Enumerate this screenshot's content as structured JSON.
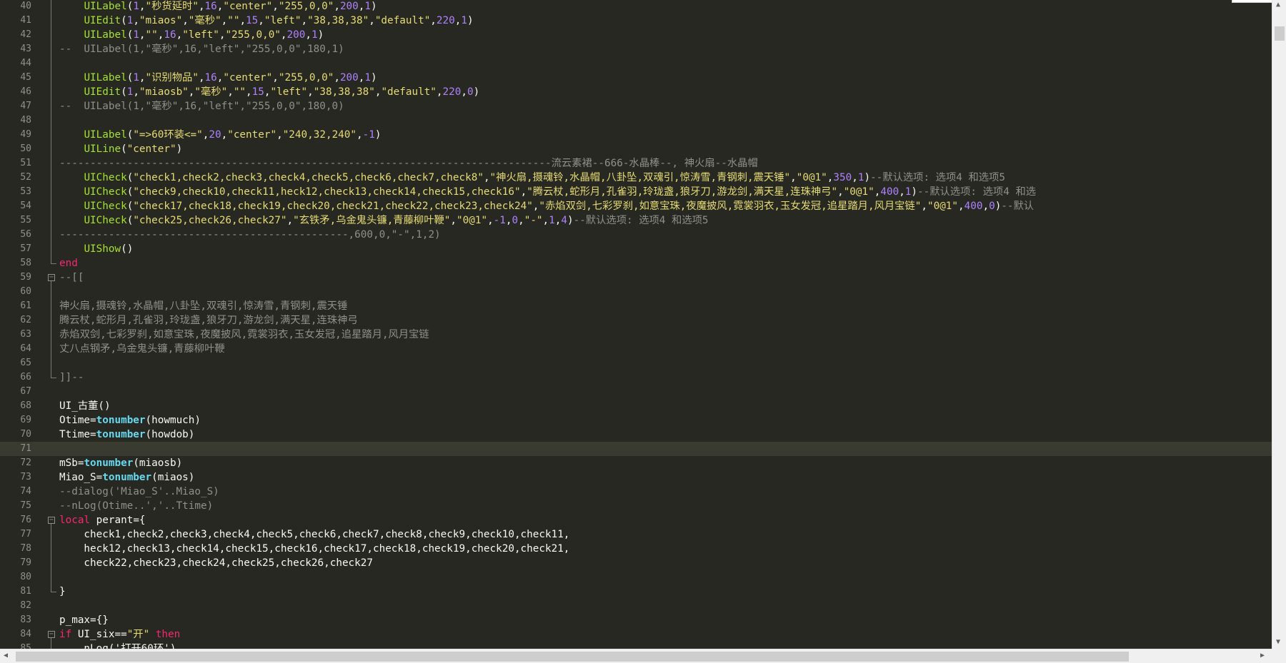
{
  "editor": {
    "current_line": 71,
    "lines": [
      {
        "n": "40",
        "fold": "line",
        "tokens": [
          [
            "tx",
            "    "
          ],
          [
            "fn",
            "UILabel"
          ],
          [
            "op",
            "("
          ],
          [
            "num",
            "1"
          ],
          [
            "op",
            ","
          ],
          [
            "str",
            "\"秒货延时\""
          ],
          [
            "op",
            ","
          ],
          [
            "num",
            "16"
          ],
          [
            "op",
            ","
          ],
          [
            "str",
            "\"center\""
          ],
          [
            "op",
            ","
          ],
          [
            "str",
            "\"255,0,0\""
          ],
          [
            "op",
            ","
          ],
          [
            "num",
            "200"
          ],
          [
            "op",
            ","
          ],
          [
            "num",
            "1"
          ],
          [
            "op",
            ")"
          ]
        ]
      },
      {
        "n": "41",
        "fold": "line",
        "tokens": [
          [
            "tx",
            "    "
          ],
          [
            "fn",
            "UIEdit"
          ],
          [
            "op",
            "("
          ],
          [
            "num",
            "1"
          ],
          [
            "op",
            ","
          ],
          [
            "str",
            "\"miaos\""
          ],
          [
            "op",
            ","
          ],
          [
            "str",
            "\"毫秒\""
          ],
          [
            "op",
            ","
          ],
          [
            "str",
            "\"\""
          ],
          [
            "op",
            ","
          ],
          [
            "num",
            "15"
          ],
          [
            "op",
            ","
          ],
          [
            "str",
            "\"left\""
          ],
          [
            "op",
            ","
          ],
          [
            "str",
            "\"38,38,38\""
          ],
          [
            "op",
            ","
          ],
          [
            "str",
            "\"default\""
          ],
          [
            "op",
            ","
          ],
          [
            "num",
            "220"
          ],
          [
            "op",
            ","
          ],
          [
            "num",
            "1"
          ],
          [
            "op",
            ")"
          ]
        ]
      },
      {
        "n": "42",
        "fold": "line",
        "tokens": [
          [
            "tx",
            "    "
          ],
          [
            "fn",
            "UILabel"
          ],
          [
            "op",
            "("
          ],
          [
            "num",
            "1"
          ],
          [
            "op",
            ","
          ],
          [
            "str",
            "\"\""
          ],
          [
            "op",
            ","
          ],
          [
            "num",
            "16"
          ],
          [
            "op",
            ","
          ],
          [
            "str",
            "\"left\""
          ],
          [
            "op",
            ","
          ],
          [
            "str",
            "\"255,0,0\""
          ],
          [
            "op",
            ","
          ],
          [
            "num",
            "200"
          ],
          [
            "op",
            ","
          ],
          [
            "num",
            "1"
          ],
          [
            "op",
            ")"
          ]
        ]
      },
      {
        "n": "43",
        "fold": "line",
        "tokens": [
          [
            "cm",
            "--  UILabel(1,\"毫秒\",16,\"left\",\"255,0,0\",180,1)"
          ]
        ]
      },
      {
        "n": "44",
        "fold": "line",
        "tokens": []
      },
      {
        "n": "45",
        "fold": "line",
        "tokens": [
          [
            "tx",
            "    "
          ],
          [
            "fn",
            "UILabel"
          ],
          [
            "op",
            "("
          ],
          [
            "num",
            "1"
          ],
          [
            "op",
            ","
          ],
          [
            "str",
            "\"识别物品\""
          ],
          [
            "op",
            ","
          ],
          [
            "num",
            "16"
          ],
          [
            "op",
            ","
          ],
          [
            "str",
            "\"center\""
          ],
          [
            "op",
            ","
          ],
          [
            "str",
            "\"255,0,0\""
          ],
          [
            "op",
            ","
          ],
          [
            "num",
            "200"
          ],
          [
            "op",
            ","
          ],
          [
            "num",
            "1"
          ],
          [
            "op",
            ")"
          ]
        ]
      },
      {
        "n": "46",
        "fold": "line",
        "tokens": [
          [
            "tx",
            "    "
          ],
          [
            "fn",
            "UIEdit"
          ],
          [
            "op",
            "("
          ],
          [
            "num",
            "1"
          ],
          [
            "op",
            ","
          ],
          [
            "str",
            "\"miaosb\""
          ],
          [
            "op",
            ","
          ],
          [
            "str",
            "\"毫秒\""
          ],
          [
            "op",
            ","
          ],
          [
            "str",
            "\"\""
          ],
          [
            "op",
            ","
          ],
          [
            "num",
            "15"
          ],
          [
            "op",
            ","
          ],
          [
            "str",
            "\"left\""
          ],
          [
            "op",
            ","
          ],
          [
            "str",
            "\"38,38,38\""
          ],
          [
            "op",
            ","
          ],
          [
            "str",
            "\"default\""
          ],
          [
            "op",
            ","
          ],
          [
            "num",
            "220"
          ],
          [
            "op",
            ","
          ],
          [
            "num",
            "0"
          ],
          [
            "op",
            ")"
          ]
        ]
      },
      {
        "n": "47",
        "fold": "line",
        "tokens": [
          [
            "cm",
            "--  UILabel(1,\"毫秒\",16,\"left\",\"255,0,0\",180,0)"
          ]
        ]
      },
      {
        "n": "48",
        "fold": "line",
        "tokens": []
      },
      {
        "n": "49",
        "fold": "line",
        "tokens": [
          [
            "tx",
            "    "
          ],
          [
            "fn",
            "UILabel"
          ],
          [
            "op",
            "("
          ],
          [
            "str",
            "\"=>60环装<=\""
          ],
          [
            "op",
            ","
          ],
          [
            "num",
            "20"
          ],
          [
            "op",
            ","
          ],
          [
            "str",
            "\"center\""
          ],
          [
            "op",
            ","
          ],
          [
            "str",
            "\"240,32,240\""
          ],
          [
            "op",
            ","
          ],
          [
            "num",
            "-1"
          ],
          [
            "op",
            ")"
          ]
        ]
      },
      {
        "n": "50",
        "fold": "line",
        "tokens": [
          [
            "tx",
            "    "
          ],
          [
            "fn",
            "UILine"
          ],
          [
            "op",
            "("
          ],
          [
            "str",
            "\"center\""
          ],
          [
            "op",
            ")"
          ]
        ]
      },
      {
        "n": "51",
        "fold": "line",
        "tokens": [
          [
            "cm",
            "--------------------------------------------------------------------------------流云素裙--666-水晶棒--, 神火扇--水晶帽"
          ]
        ]
      },
      {
        "n": "52",
        "fold": "line",
        "tokens": [
          [
            "tx",
            "    "
          ],
          [
            "fn",
            "UICheck"
          ],
          [
            "op",
            "("
          ],
          [
            "str",
            "\"check1,check2,check3,check4,check5,check6,check7,check8\""
          ],
          [
            "op",
            ","
          ],
          [
            "str",
            "\"神火扇,摄魂铃,水晶帽,八卦坠,双魂引,惊涛雪,青钢刺,震天锤\""
          ],
          [
            "op",
            ","
          ],
          [
            "str",
            "\"0@1\""
          ],
          [
            "op",
            ","
          ],
          [
            "num",
            "350"
          ],
          [
            "op",
            ","
          ],
          [
            "num",
            "1"
          ],
          [
            "op",
            ")"
          ],
          [
            "cm",
            "--默认选项: 选项4 和选项5"
          ]
        ]
      },
      {
        "n": "53",
        "fold": "line",
        "tokens": [
          [
            "tx",
            "    "
          ],
          [
            "fn",
            "UICheck"
          ],
          [
            "op",
            "("
          ],
          [
            "str",
            "\"check9,check10,check11,heck12,check13,check14,check15,check16\""
          ],
          [
            "op",
            ","
          ],
          [
            "str",
            "\"腾云杖,蛇形月,孔雀羽,玲珑盏,狼牙刀,游龙剑,满天星,连珠神弓\""
          ],
          [
            "op",
            ","
          ],
          [
            "str",
            "\"0@1\""
          ],
          [
            "op",
            ","
          ],
          [
            "num",
            "400"
          ],
          [
            "op",
            ","
          ],
          [
            "num",
            "1"
          ],
          [
            "op",
            ")"
          ],
          [
            "cm",
            "--默认选项: 选项4 和选"
          ]
        ]
      },
      {
        "n": "54",
        "fold": "line",
        "tokens": [
          [
            "tx",
            "    "
          ],
          [
            "fn",
            "UICheck"
          ],
          [
            "op",
            "("
          ],
          [
            "str",
            "\"check17,check18,check19,check20,check21,check22,check23,check24\""
          ],
          [
            "op",
            ","
          ],
          [
            "str",
            "\"赤焰双剑,七彩罗刹,如意宝珠,夜魔披风,霓裳羽衣,玉女发冠,追星踏月,风月宝链\""
          ],
          [
            "op",
            ","
          ],
          [
            "str",
            "\"0@1\""
          ],
          [
            "op",
            ","
          ],
          [
            "num",
            "400"
          ],
          [
            "op",
            ","
          ],
          [
            "num",
            "0"
          ],
          [
            "op",
            ")"
          ],
          [
            "cm",
            "--默认"
          ]
        ]
      },
      {
        "n": "55",
        "fold": "line",
        "tokens": [
          [
            "tx",
            "    "
          ],
          [
            "fn",
            "UICheck"
          ],
          [
            "op",
            "("
          ],
          [
            "str",
            "\"check25,check26,check27\""
          ],
          [
            "op",
            ","
          ],
          [
            "str",
            "\"玄铁矛,乌金鬼头镰,青藤柳叶鞭\""
          ],
          [
            "op",
            ","
          ],
          [
            "str",
            "\"0@1\""
          ],
          [
            "op",
            ","
          ],
          [
            "num",
            "-1"
          ],
          [
            "op",
            ","
          ],
          [
            "num",
            "0"
          ],
          [
            "op",
            ","
          ],
          [
            "str",
            "\"-\""
          ],
          [
            "op",
            ","
          ],
          [
            "num",
            "1"
          ],
          [
            "op",
            ","
          ],
          [
            "num",
            "4"
          ],
          [
            "op",
            ")"
          ],
          [
            "cm",
            "--默认选项: 选项4 和选项5"
          ]
        ]
      },
      {
        "n": "56",
        "fold": "line",
        "tokens": [
          [
            "cm",
            "-----------------------------------------------,600,0,\"-\",1,2)"
          ]
        ]
      },
      {
        "n": "57",
        "fold": "line",
        "tokens": [
          [
            "tx",
            "    "
          ],
          [
            "fn",
            "UIShow"
          ],
          [
            "op",
            "()"
          ]
        ]
      },
      {
        "n": "58",
        "fold": "end",
        "tokens": [
          [
            "kw",
            "end"
          ]
        ]
      },
      {
        "n": "59",
        "fold": "box",
        "tokens": [
          [
            "cm",
            "--[["
          ]
        ]
      },
      {
        "n": "60",
        "fold": "line",
        "tokens": []
      },
      {
        "n": "61",
        "fold": "line",
        "tokens": [
          [
            "cm",
            "神火扇,摄魂铃,水晶帽,八卦坠,双魂引,惊涛雪,青钢刺,震天锤"
          ]
        ]
      },
      {
        "n": "62",
        "fold": "line",
        "tokens": [
          [
            "cm",
            "腾云杖,蛇形月,孔雀羽,玲珑盏,狼牙刀,游龙剑,满天星,连珠神弓"
          ]
        ]
      },
      {
        "n": "63",
        "fold": "line",
        "tokens": [
          [
            "cm",
            "赤焰双剑,七彩罗刹,如意宝珠,夜魔披风,霓裳羽衣,玉女发冠,追星踏月,风月宝链"
          ]
        ]
      },
      {
        "n": "64",
        "fold": "line",
        "tokens": [
          [
            "cm",
            "丈八点钢矛,乌金鬼头镰,青藤柳叶鞭"
          ]
        ]
      },
      {
        "n": "65",
        "fold": "line",
        "tokens": []
      },
      {
        "n": "66",
        "fold": "end",
        "tokens": [
          [
            "cm",
            "]]--"
          ]
        ]
      },
      {
        "n": "67",
        "fold": "",
        "tokens": []
      },
      {
        "n": "68",
        "fold": "",
        "tokens": [
          [
            "tx",
            "UI_古董"
          ],
          [
            "op",
            "()"
          ]
        ]
      },
      {
        "n": "69",
        "fold": "",
        "tokens": [
          [
            "tx",
            "Otime"
          ],
          [
            "op",
            "="
          ],
          [
            "bi",
            "tonumber"
          ],
          [
            "op",
            "("
          ],
          [
            "tx",
            "howmuch"
          ],
          [
            "op",
            ")"
          ]
        ]
      },
      {
        "n": "70",
        "fold": "",
        "tokens": [
          [
            "tx",
            "Ttime"
          ],
          [
            "op",
            "="
          ],
          [
            "bi",
            "tonumber"
          ],
          [
            "op",
            "("
          ],
          [
            "tx",
            "howdob"
          ],
          [
            "op",
            ")"
          ]
        ]
      },
      {
        "n": "71",
        "fold": "",
        "tokens": []
      },
      {
        "n": "72",
        "fold": "",
        "tokens": [
          [
            "tx",
            "mSb"
          ],
          [
            "op",
            "="
          ],
          [
            "bi",
            "tonumber"
          ],
          [
            "op",
            "("
          ],
          [
            "tx",
            "miaosb"
          ],
          [
            "op",
            ")"
          ]
        ]
      },
      {
        "n": "73",
        "fold": "",
        "tokens": [
          [
            "tx",
            "Miao_S"
          ],
          [
            "op",
            "="
          ],
          [
            "bi",
            "tonumber"
          ],
          [
            "op",
            "("
          ],
          [
            "tx",
            "miaos"
          ],
          [
            "op",
            ")"
          ]
        ]
      },
      {
        "n": "74",
        "fold": "",
        "tokens": [
          [
            "cm",
            "--dialog('Miao_S'..Miao_S)"
          ]
        ]
      },
      {
        "n": "75",
        "fold": "",
        "tokens": [
          [
            "cm",
            "--nLog(Otime..','..Ttime)"
          ]
        ]
      },
      {
        "n": "76",
        "fold": "box",
        "tokens": [
          [
            "kw",
            "local"
          ],
          [
            "tx",
            " perant"
          ],
          [
            "op",
            "={"
          ]
        ]
      },
      {
        "n": "77",
        "fold": "line",
        "tokens": [
          [
            "tx",
            "    check1,check2,check3,check4,check5,check6,check7,check8,check9,check10,check11,"
          ]
        ]
      },
      {
        "n": "78",
        "fold": "line",
        "tokens": [
          [
            "tx",
            "    heck12,check13,check14,check15,check16,check17,check18,check19,check20,check21,"
          ]
        ]
      },
      {
        "n": "79",
        "fold": "line",
        "tokens": [
          [
            "tx",
            "    check22,check23,check24,check25,check26,check27"
          ]
        ]
      },
      {
        "n": "80",
        "fold": "line",
        "tokens": []
      },
      {
        "n": "81",
        "fold": "end",
        "tokens": [
          [
            "op",
            "}"
          ]
        ]
      },
      {
        "n": "82",
        "fold": "",
        "tokens": []
      },
      {
        "n": "83",
        "fold": "",
        "tokens": [
          [
            "tx",
            "p_max"
          ],
          [
            "op",
            "={}"
          ]
        ]
      },
      {
        "n": "84",
        "fold": "box",
        "tokens": [
          [
            "kw",
            "if"
          ],
          [
            "tx",
            " UI_six"
          ],
          [
            "op",
            "=="
          ],
          [
            "str",
            "\"开\""
          ],
          [
            "tx",
            " "
          ],
          [
            "kw",
            "then"
          ]
        ]
      },
      {
        "n": "85",
        "fold": "line",
        "tokens": [
          [
            "tx",
            "    nLog('打开60环')"
          ]
        ]
      }
    ]
  }
}
